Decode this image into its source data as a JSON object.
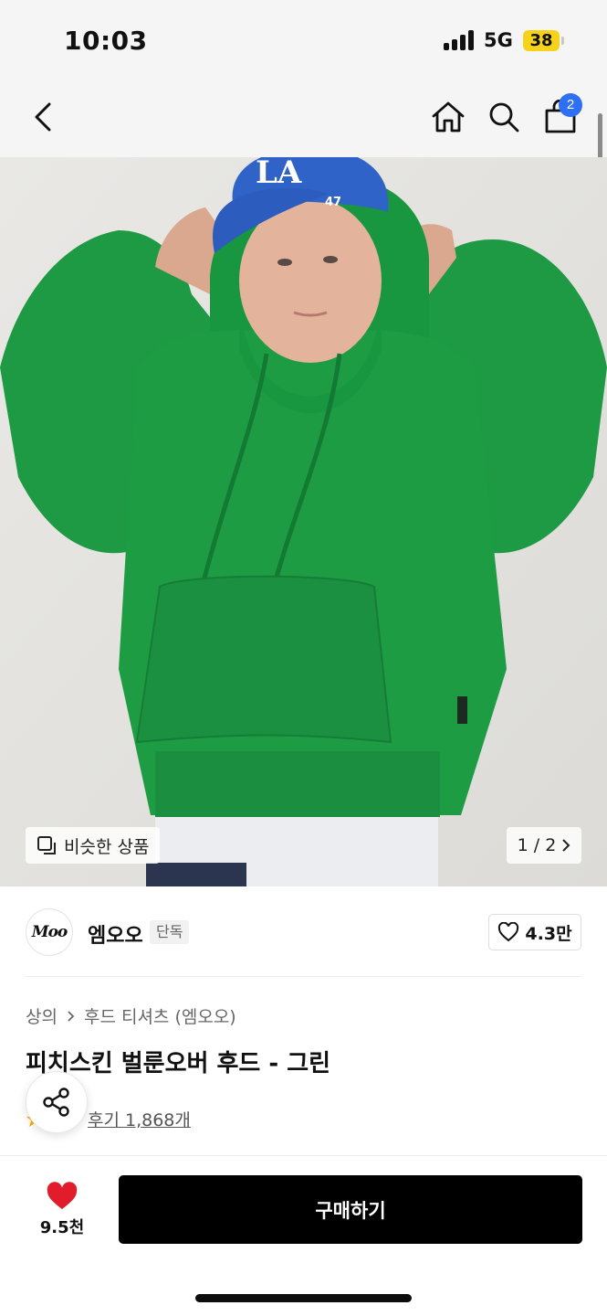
{
  "status_bar": {
    "time": "10:03",
    "network": "5G",
    "battery": "38"
  },
  "nav": {
    "cart_count": "2",
    "icons": [
      "back-icon",
      "home-icon",
      "search-icon",
      "cart-icon"
    ]
  },
  "image": {
    "similar_label": "비슷한 상품",
    "page_indicator": "1 / 2",
    "cap_logo": "LA",
    "cap_tag": "47",
    "colors": {
      "hoodie": "#1f9e45",
      "cap": "#2f63c8",
      "background": "#e6e5e2"
    }
  },
  "brand": {
    "logo_text": "Moo",
    "name": "엠오오",
    "tag": "단독",
    "likes": "4.3만"
  },
  "breadcrumb": {
    "category": "상의",
    "subcategory": "후드 티셔츠 (엠오오)"
  },
  "product": {
    "title": "피치스킨 벌룬오버 후드 - 그린"
  },
  "review": {
    "link_label": "후기 1,868개"
  },
  "bottom_bar": {
    "wish_count": "9.5천",
    "buy_label": "구매하기"
  },
  "colors": {
    "badge": "#2f6ff4",
    "heart": "#e11d2b",
    "battery": "#f6d21b"
  }
}
